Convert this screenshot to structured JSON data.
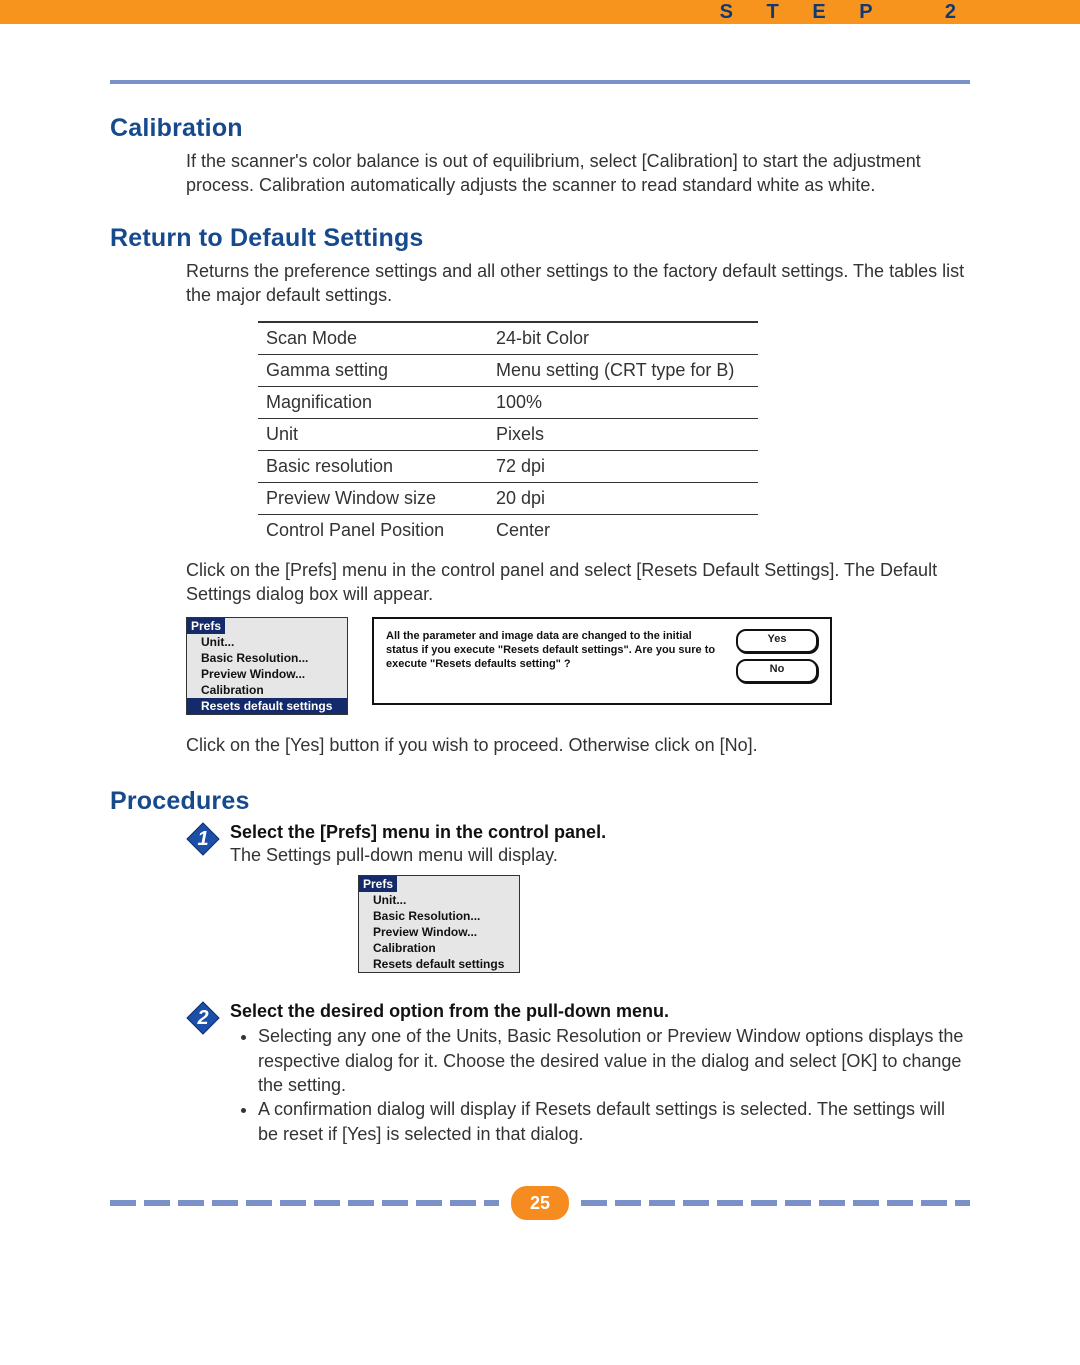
{
  "header": {
    "step_label": "S T E P   2"
  },
  "sections": {
    "calibration": {
      "title": "Calibration",
      "text": "If the scanner's color balance is out of equilibrium, select [Calibration] to start the adjustment process. Calibration automatically adjusts the scanner to read standard white as white."
    },
    "defaults": {
      "title": "Return to Default Settings",
      "intro": "Returns the preference settings and all other settings to the factory default settings. The tables list the major default settings.",
      "table": [
        {
          "k": "Scan Mode",
          "v": "24-bit Color"
        },
        {
          "k": "Gamma setting",
          "v": "Menu setting (CRT type for B)"
        },
        {
          "k": "Magnification",
          "v": "100%"
        },
        {
          "k": "Unit",
          "v": "Pixels"
        },
        {
          "k": "Basic resolution",
          "v": "72 dpi"
        },
        {
          "k": "Preview Window size",
          "v": "20 dpi"
        },
        {
          "k": "Control Panel Position",
          "v": "Center"
        }
      ],
      "after_table": "Click on the [Prefs] menu in the control panel and select [Resets Default Settings]. The Default Settings dialog box will appear.",
      "menu": {
        "title": "Prefs",
        "items": [
          "Unit...",
          "Basic Resolution...",
          "Preview Window...",
          "Calibration",
          "Resets default settings"
        ],
        "selected_index": 4
      },
      "dialog": {
        "message": "All the parameter and image data are changed to the initial status if you execute \"Resets default settings\". Are you sure to execute \"Resets defaults setting\" ?",
        "yes": "Yes",
        "no": "No"
      },
      "after_dialog": "Click on the [Yes] button if you wish to proceed. Otherwise click on [No]."
    },
    "procedures": {
      "title": "Procedures",
      "steps": [
        {
          "num": "1",
          "head": "Select the [Prefs] menu in the control panel.",
          "body": "The Settings pull-down menu will display.",
          "show_menu": true
        },
        {
          "num": "2",
          "head": "Select the desired option from the pull-down menu.",
          "bullets": [
            "Selecting any one of the Units, Basic Resolution or Preview Window options displays the respective dialog for it. Choose the desired value in the dialog and select [OK] to change the setting.",
            "A confirmation dialog will display if Resets default settings is selected. The settings will be reset if [Yes] is selected in that dialog."
          ]
        }
      ],
      "menu2": {
        "title": "Prefs",
        "items": [
          "Unit...",
          "Basic Resolution...",
          "Preview Window...",
          "Calibration",
          "Resets default settings"
        ]
      }
    }
  },
  "page_number": "25"
}
